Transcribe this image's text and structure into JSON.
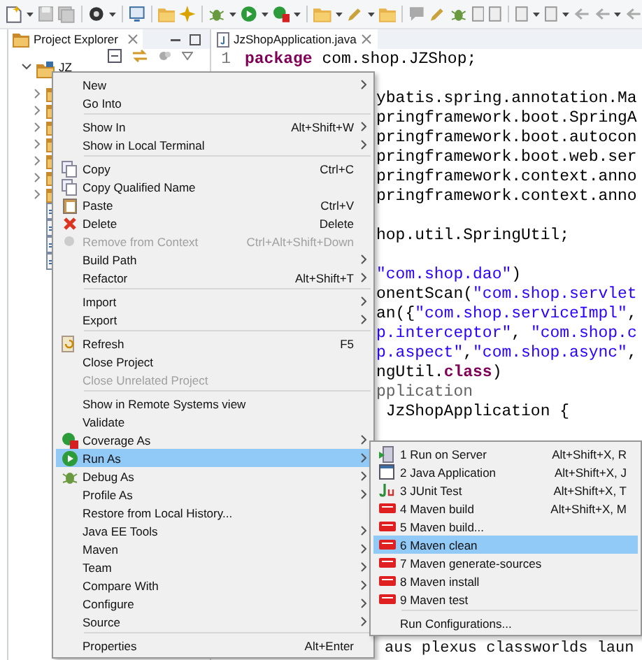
{
  "explorer": {
    "tab": {
      "label": "Project Explorer",
      "selected": true
    },
    "tree": {
      "label": "JZ",
      "expanded": true,
      "children": [
        {
          "kind": "folder",
          "expanded": false
        },
        {
          "kind": "folder",
          "expanded": false
        },
        {
          "kind": "folder",
          "expanded": false
        },
        {
          "kind": "folder",
          "expanded": false
        },
        {
          "kind": "folder",
          "expanded": false
        },
        {
          "kind": "folder",
          "expanded": false
        },
        {
          "kind": "folder",
          "expanded": false
        },
        {
          "kind": "file"
        },
        {
          "kind": "file"
        },
        {
          "kind": "file"
        },
        {
          "kind": "file"
        }
      ]
    }
  },
  "editor": {
    "tab": {
      "label": "JzShopApplication.java",
      "selected": true
    },
    "first_line": {
      "number": "1",
      "tokens": [
        {
          "kind": "keyword",
          "text": "package"
        },
        {
          "kind": "plain",
          "text": " com.shop.JZShop;"
        }
      ]
    },
    "partial_lines": [
      {
        "kind": "blank"
      },
      {
        "kind": "code",
        "tokens": [
          {
            "kind": "plain",
            "text": "ybatis.spring.annotation.Ma"
          }
        ]
      },
      {
        "kind": "code",
        "tokens": [
          {
            "kind": "plain",
            "text": "pringframework.boot.SpringA"
          }
        ]
      },
      {
        "kind": "code",
        "tokens": [
          {
            "kind": "plain",
            "text": "pringframework.boot.autocon"
          }
        ]
      },
      {
        "kind": "code",
        "tokens": [
          {
            "kind": "plain",
            "text": "pringframework.boot.web.ser"
          }
        ]
      },
      {
        "kind": "code",
        "tokens": [
          {
            "kind": "plain",
            "text": "pringframework.context.anno"
          }
        ]
      },
      {
        "kind": "code",
        "tokens": [
          {
            "kind": "plain",
            "text": "pringframework.context.anno"
          }
        ]
      },
      {
        "kind": "blank"
      },
      {
        "kind": "code",
        "tokens": [
          {
            "kind": "plain",
            "text": "hop.util.SpringUtil;"
          }
        ]
      },
      {
        "kind": "blank"
      },
      {
        "kind": "code",
        "tokens": [
          {
            "kind": "string",
            "text": "\"com.shop.dao\""
          },
          {
            "kind": "plain",
            "text": ")"
          }
        ]
      },
      {
        "kind": "code",
        "tokens": [
          {
            "kind": "plain",
            "text": "onentScan("
          },
          {
            "kind": "string",
            "text": "\"com.shop.servlet"
          }
        ]
      },
      {
        "kind": "code",
        "tokens": [
          {
            "kind": "plain",
            "text": "an({"
          },
          {
            "kind": "string",
            "text": "\"com.shop.serviceImpl\""
          },
          {
            "kind": "plain",
            "text": ","
          }
        ]
      },
      {
        "kind": "code",
        "tokens": [
          {
            "kind": "string",
            "text": "p.interceptor\""
          },
          {
            "kind": "plain",
            "text": ", "
          },
          {
            "kind": "string",
            "text": "\"com.shop.c"
          }
        ]
      },
      {
        "kind": "code",
        "tokens": [
          {
            "kind": "string",
            "text": "p.aspect\""
          },
          {
            "kind": "plain",
            "text": ","
          },
          {
            "kind": "string",
            "text": "\"com.shop.async\""
          },
          {
            "kind": "plain",
            "text": ","
          }
        ]
      },
      {
        "kind": "code",
        "tokens": [
          {
            "kind": "plain",
            "text": "ngUtil."
          },
          {
            "kind": "keyword",
            "text": "class"
          },
          {
            "kind": "plain",
            "text": ")"
          }
        ]
      },
      {
        "kind": "code",
        "tokens": [
          {
            "kind": "annotation",
            "text": "pplication"
          }
        ]
      },
      {
        "kind": "code",
        "tokens": [
          {
            "kind": "plain",
            "text": " JzShopApplication {"
          }
        ]
      }
    ],
    "console_tail": "aus plexus classworlds laun"
  },
  "context_menu": {
    "items": [
      {
        "kind": "item",
        "label": "New",
        "submenu": true,
        "disabled": false,
        "selected": false
      },
      {
        "kind": "item",
        "label": "Go Into",
        "submenu": false,
        "disabled": false,
        "selected": false
      },
      {
        "kind": "separator"
      },
      {
        "kind": "item",
        "label": "Show In",
        "shortcut": "Alt+Shift+W",
        "submenu": true,
        "disabled": false,
        "selected": false
      },
      {
        "kind": "item",
        "label": "Show in Local Terminal",
        "submenu": true,
        "disabled": false,
        "selected": false
      },
      {
        "kind": "separator"
      },
      {
        "kind": "item",
        "label": "Copy",
        "shortcut": "Ctrl+C",
        "submenu": false,
        "disabled": false,
        "selected": false
      },
      {
        "kind": "item",
        "label": "Copy Qualified Name",
        "submenu": false,
        "disabled": false,
        "selected": false
      },
      {
        "kind": "item",
        "label": "Paste",
        "shortcut": "Ctrl+V",
        "submenu": false,
        "disabled": false,
        "selected": false
      },
      {
        "kind": "item",
        "label": "Delete",
        "shortcut": "Delete",
        "submenu": false,
        "disabled": false,
        "selected": false
      },
      {
        "kind": "item",
        "label": "Remove from Context",
        "shortcut": "Ctrl+Alt+Shift+Down",
        "submenu": false,
        "disabled": true,
        "selected": false
      },
      {
        "kind": "item",
        "label": "Build Path",
        "submenu": true,
        "disabled": false,
        "selected": false
      },
      {
        "kind": "item",
        "label": "Refactor",
        "shortcut": "Alt+Shift+T",
        "submenu": true,
        "disabled": false,
        "selected": false
      },
      {
        "kind": "separator"
      },
      {
        "kind": "item",
        "label": "Import",
        "submenu": true,
        "disabled": false,
        "selected": false
      },
      {
        "kind": "item",
        "label": "Export",
        "submenu": true,
        "disabled": false,
        "selected": false
      },
      {
        "kind": "separator"
      },
      {
        "kind": "item",
        "label": "Refresh",
        "shortcut": "F5",
        "submenu": false,
        "disabled": false,
        "selected": false
      },
      {
        "kind": "item",
        "label": "Close Project",
        "submenu": false,
        "disabled": false,
        "selected": false
      },
      {
        "kind": "item",
        "label": "Close Unrelated Project",
        "submenu": false,
        "disabled": true,
        "selected": false
      },
      {
        "kind": "separator"
      },
      {
        "kind": "item",
        "label": "Show in Remote Systems view",
        "submenu": false,
        "disabled": false,
        "selected": false
      },
      {
        "kind": "item",
        "label": "Validate",
        "submenu": false,
        "disabled": false,
        "selected": false
      },
      {
        "kind": "item",
        "label": "Coverage As",
        "submenu": true,
        "disabled": false,
        "selected": false
      },
      {
        "kind": "item",
        "label": "Run As",
        "submenu": true,
        "disabled": false,
        "selected": true
      },
      {
        "kind": "item",
        "label": "Debug As",
        "submenu": true,
        "disabled": false,
        "selected": false
      },
      {
        "kind": "item",
        "label": "Profile As",
        "submenu": true,
        "disabled": false,
        "selected": false
      },
      {
        "kind": "item",
        "label": "Restore from Local History...",
        "submenu": false,
        "disabled": false,
        "selected": false
      },
      {
        "kind": "item",
        "label": "Java EE Tools",
        "submenu": true,
        "disabled": false,
        "selected": false
      },
      {
        "kind": "item",
        "label": "Maven",
        "submenu": true,
        "disabled": false,
        "selected": false
      },
      {
        "kind": "item",
        "label": "Team",
        "submenu": true,
        "disabled": false,
        "selected": false
      },
      {
        "kind": "item",
        "label": "Compare With",
        "submenu": true,
        "disabled": false,
        "selected": false
      },
      {
        "kind": "item",
        "label": "Configure",
        "submenu": true,
        "disabled": false,
        "selected": false
      },
      {
        "kind": "item",
        "label": "Source",
        "submenu": true,
        "disabled": false,
        "selected": false
      },
      {
        "kind": "separator"
      },
      {
        "kind": "item",
        "label": "Properties",
        "shortcut": "Alt+Enter",
        "submenu": false,
        "disabled": false,
        "selected": false
      }
    ]
  },
  "run_as_menu": {
    "items": [
      {
        "kind": "item",
        "label": "1 Run on Server",
        "shortcut": "Alt+Shift+X, R",
        "selected": false
      },
      {
        "kind": "item",
        "label": "2 Java Application",
        "shortcut": "Alt+Shift+X, J",
        "selected": false
      },
      {
        "kind": "item",
        "label": "3 JUnit Test",
        "shortcut": "Alt+Shift+X, T",
        "selected": false
      },
      {
        "kind": "item",
        "label": "4 Maven build",
        "shortcut": "Alt+Shift+X, M",
        "selected": false
      },
      {
        "kind": "item",
        "label": "5 Maven build...",
        "selected": false
      },
      {
        "kind": "item",
        "label": "6 Maven clean",
        "selected": true
      },
      {
        "kind": "item",
        "label": "7 Maven generate-sources",
        "selected": false
      },
      {
        "kind": "item",
        "label": "8 Maven install",
        "selected": false
      },
      {
        "kind": "item",
        "label": "9 Maven test",
        "selected": false
      },
      {
        "kind": "separator"
      },
      {
        "kind": "item",
        "label": "Run Configurations...",
        "selected": false
      }
    ]
  }
}
